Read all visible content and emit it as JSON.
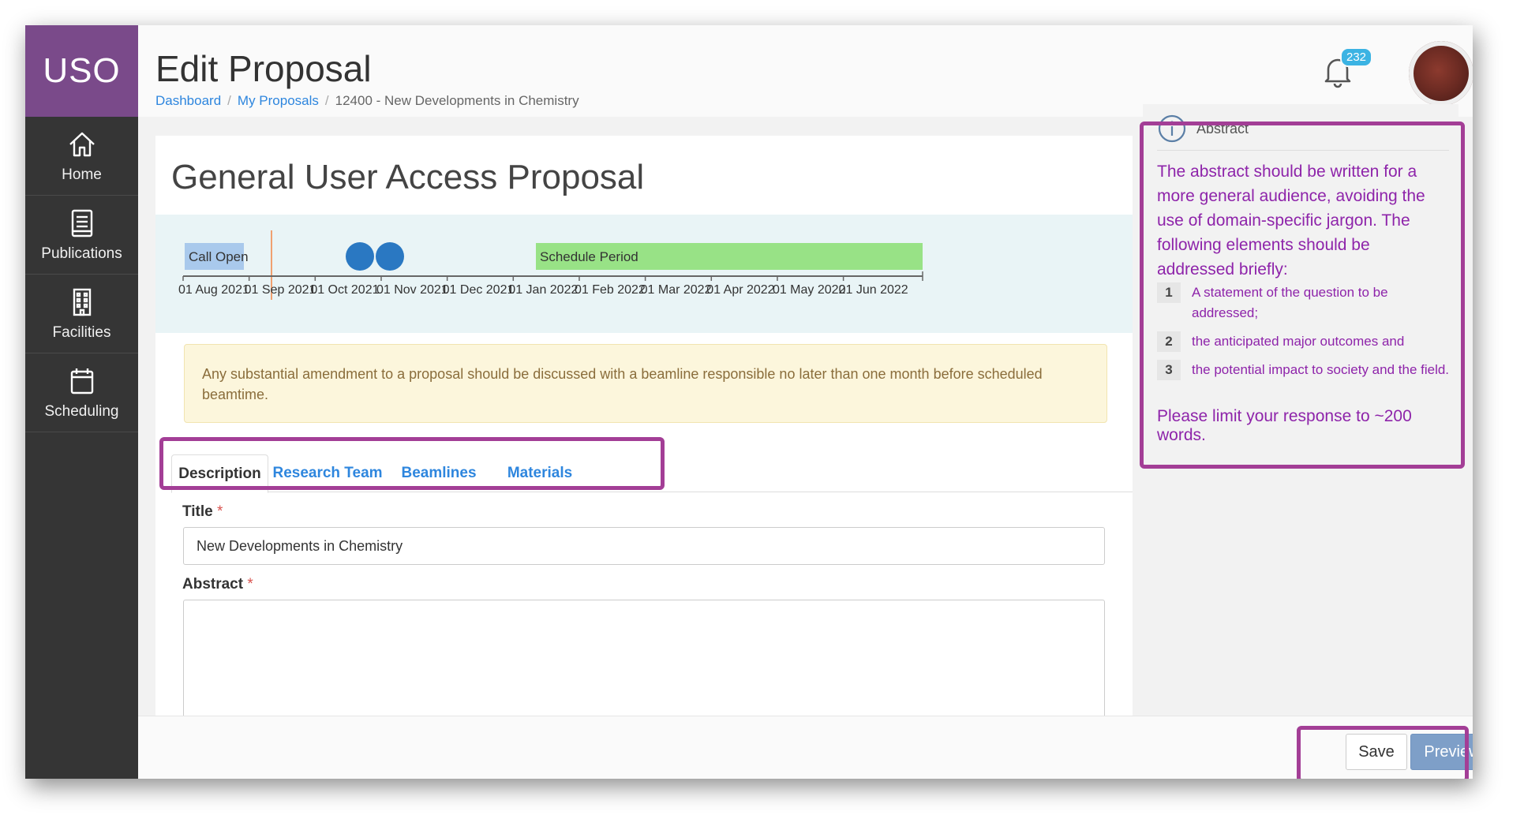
{
  "app": {
    "logo": "USO"
  },
  "sidebar": {
    "items": [
      {
        "label": "Home",
        "icon": "home-icon"
      },
      {
        "label": "Publications",
        "icon": "book-icon"
      },
      {
        "label": "Facilities",
        "icon": "building-icon"
      },
      {
        "label": "Scheduling",
        "icon": "calendar-icon"
      }
    ]
  },
  "header": {
    "title": "Edit Proposal",
    "breadcrumb": [
      "Dashboard",
      "My Proposals",
      "12400 - New Developments in Chemistry"
    ],
    "notification_count": "232"
  },
  "card": {
    "title": "General User Access Proposal"
  },
  "timeline": {
    "ticks": [
      "01 Aug 2021",
      "01 Sep 2021",
      "01 Oct 2021",
      "01 Nov 2021",
      "01 Dec 2021",
      "01 Jan 2022",
      "01 Feb 2022",
      "01 Mar 2022",
      "01 Apr 2022",
      "01 May 2022",
      "01 Jun 2022"
    ],
    "call_open_label": "Call Open",
    "schedule_period_label": "Schedule Period",
    "colors": {
      "call_open": "#a9c9ec",
      "schedule_period": "#98e286",
      "marker": "#2a78c2",
      "today": "#f0a070"
    }
  },
  "notice": "Any substantial amendment to a proposal should be discussed with a beamline responsible no later than one month before scheduled beamtime.",
  "tabs": [
    "Description",
    "Research Team",
    "Beamlines",
    "Materials"
  ],
  "form": {
    "title_label": "Title",
    "title_value": "New Developments in Chemistry",
    "abstract_label": "Abstract",
    "required_mark": "*"
  },
  "help": {
    "heading": "Abstract",
    "intro": "The abstract should be written for a more general audience, avoiding the use of domain-specific jargon. The following elements should be addressed briefly:",
    "items": [
      {
        "num": "1",
        "text": "A statement of the question to be addressed;"
      },
      {
        "num": "2",
        "text": "the anticipated major outcomes and"
      },
      {
        "num": "3",
        "text": "the potential impact to society and the field."
      }
    ],
    "footer": "Please limit your response to ~200 words."
  },
  "actions": {
    "save": "Save",
    "preview": "Preview"
  },
  "colors": {
    "brand": "#7a4a8a",
    "sidebar": "#353535",
    "highlight": "#a33e96",
    "link": "#2e86de"
  }
}
